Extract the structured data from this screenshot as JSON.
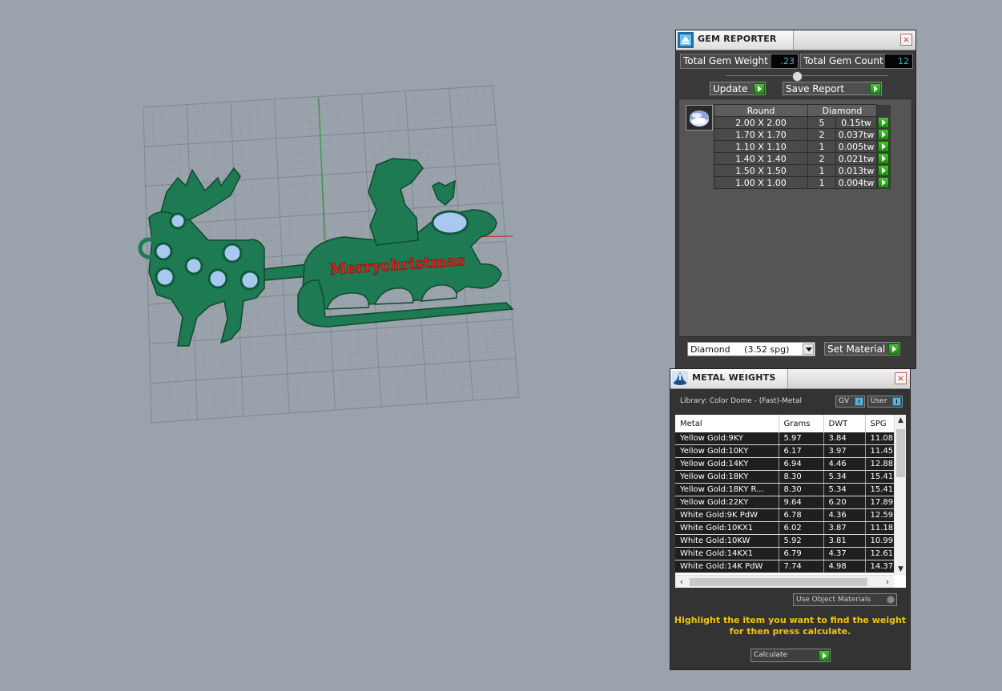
{
  "viewport": {
    "model_text": "Merrychristmas"
  },
  "gem_reporter": {
    "title": "GEM REPORTER",
    "close_label": "×",
    "total_weight_label": "Total Gem Weight",
    "total_weight_value": ".23",
    "total_count_label": "Total Gem Count",
    "total_count_value": "12",
    "update_label": "Update",
    "save_report_label": "Save Report",
    "table": {
      "headers": [
        "Round",
        "Diamond"
      ],
      "rows": [
        {
          "size": "2.00 X 2.00",
          "count": "5",
          "weight": "0.15tw"
        },
        {
          "size": "1.70 X 1.70",
          "count": "2",
          "weight": "0.037tw"
        },
        {
          "size": "1.10 X 1.10",
          "count": "1",
          "weight": "0.005tw"
        },
        {
          "size": "1.40 X 1.40",
          "count": "2",
          "weight": "0.021tw"
        },
        {
          "size": "1.50 X 1.50",
          "count": "1",
          "weight": "0.013tw"
        },
        {
          "size": "1.00 X 1.00",
          "count": "1",
          "weight": "0.004tw"
        }
      ]
    },
    "material_select": "Diamond     (3.52 spg)",
    "set_material_label": "Set Material"
  },
  "metal_weights": {
    "title": "METAL WEIGHTS",
    "close_label": "×",
    "library_text": "Library: Color Dome - (Fast)-Metal",
    "gv_label": "GV",
    "user_label": "User",
    "columns": [
      "Metal",
      "Grams",
      "DWT",
      "SPG"
    ],
    "rows": [
      [
        "Yellow Gold:9KY",
        "5.97",
        "3.84",
        "11.08"
      ],
      [
        "Yellow Gold:10KY",
        "6.17",
        "3.97",
        "11.45"
      ],
      [
        "Yellow Gold:14KY",
        "6.94",
        "4.46",
        "12.88"
      ],
      [
        "Yellow Gold:18KY",
        "8.30",
        "5.34",
        "15.41"
      ],
      [
        "Yellow Gold:18KY R...",
        "8.30",
        "5.34",
        "15.41"
      ],
      [
        "Yellow Gold:22KY",
        "9.64",
        "6.20",
        "17.89"
      ],
      [
        "White Gold:9K PdW",
        "6.78",
        "4.36",
        "12.59"
      ],
      [
        "White Gold:10KX1",
        "6.02",
        "3.87",
        "11.18"
      ],
      [
        "White Gold:10KW",
        "5.92",
        "3.81",
        "10.99"
      ],
      [
        "White Gold:14KX1",
        "6.79",
        "4.37",
        "12.61"
      ],
      [
        "White Gold:14K PdW",
        "7.74",
        "4.98",
        "14.37"
      ]
    ],
    "use_object_materials_label": "Use Object Materials",
    "hint_line1": "Highlight the item you want to find the weight",
    "hint_line2": "for then press calculate.",
    "calculate_label": "Calculate"
  }
}
